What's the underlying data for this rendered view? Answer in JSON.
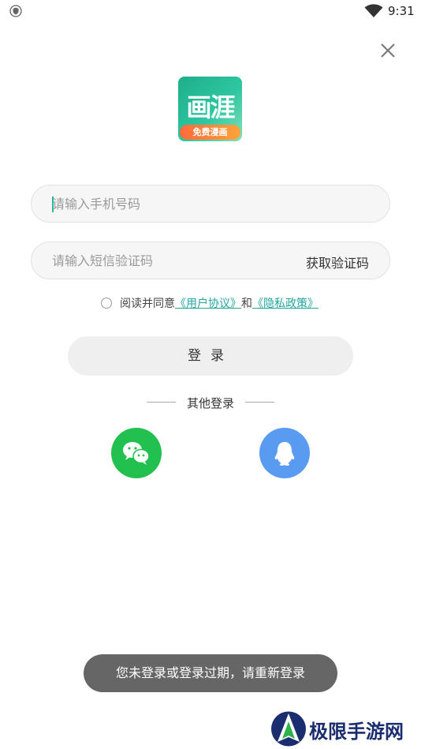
{
  "status_bar": {
    "time": "9:31"
  },
  "logo": {
    "title": "画涯",
    "tagline": "免费漫画"
  },
  "form": {
    "phone_placeholder": "请输入手机号码",
    "code_placeholder": "请输入短信验证码",
    "get_code_label": "获取验证码",
    "agree_prefix": "阅读并同意",
    "user_agreement": "《用户协议》",
    "agree_and": "和",
    "privacy_policy": "《隐私政策》",
    "login_label": "登录"
  },
  "other_login": {
    "title": "其他登录",
    "options": [
      "wechat",
      "qq"
    ]
  },
  "toast": {
    "message": "您未登录或登录过期，请重新登录"
  },
  "watermark": {
    "text": "极限手游网"
  },
  "colors": {
    "accent": "#22a6a0",
    "wechat": "#22c04f",
    "qq": "#5a9bf2",
    "toast_bg": "#666666"
  }
}
